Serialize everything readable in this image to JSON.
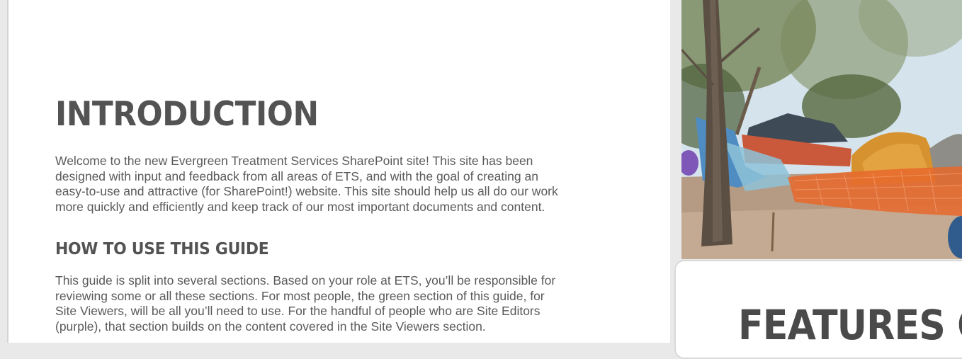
{
  "introduction": {
    "heading": "INTRODUCTION",
    "paragraph_lines": [
      "Welcome to the new Evergreen Treatment Services SharePoint site! This site has been",
      "designed with input and feedback from all areas of ETS, and with the goal of creating an",
      "easy-to-use and attractive (for SharePoint!) website. This site should help us all do our work",
      "more quickly and efficiently and keep track of our most important documents and content."
    ]
  },
  "guide": {
    "heading": "HOW TO USE THIS GUIDE",
    "paragraph_lines": [
      "This guide is split into several sections. Based on your role at ETS, you’ll be responsible for",
      "reviewing some or all these sections. For most people, the green section of this guide, for",
      "Site Viewers, will be all you’ll need to use. For the handful of people who are Site Editors",
      "(purple), that section builds on the content covered in the Site Viewers section."
    ]
  },
  "features_card": {
    "heading": "FEATURES O"
  },
  "photo": {
    "subject": "encampment-tents-under-trees-photo"
  }
}
